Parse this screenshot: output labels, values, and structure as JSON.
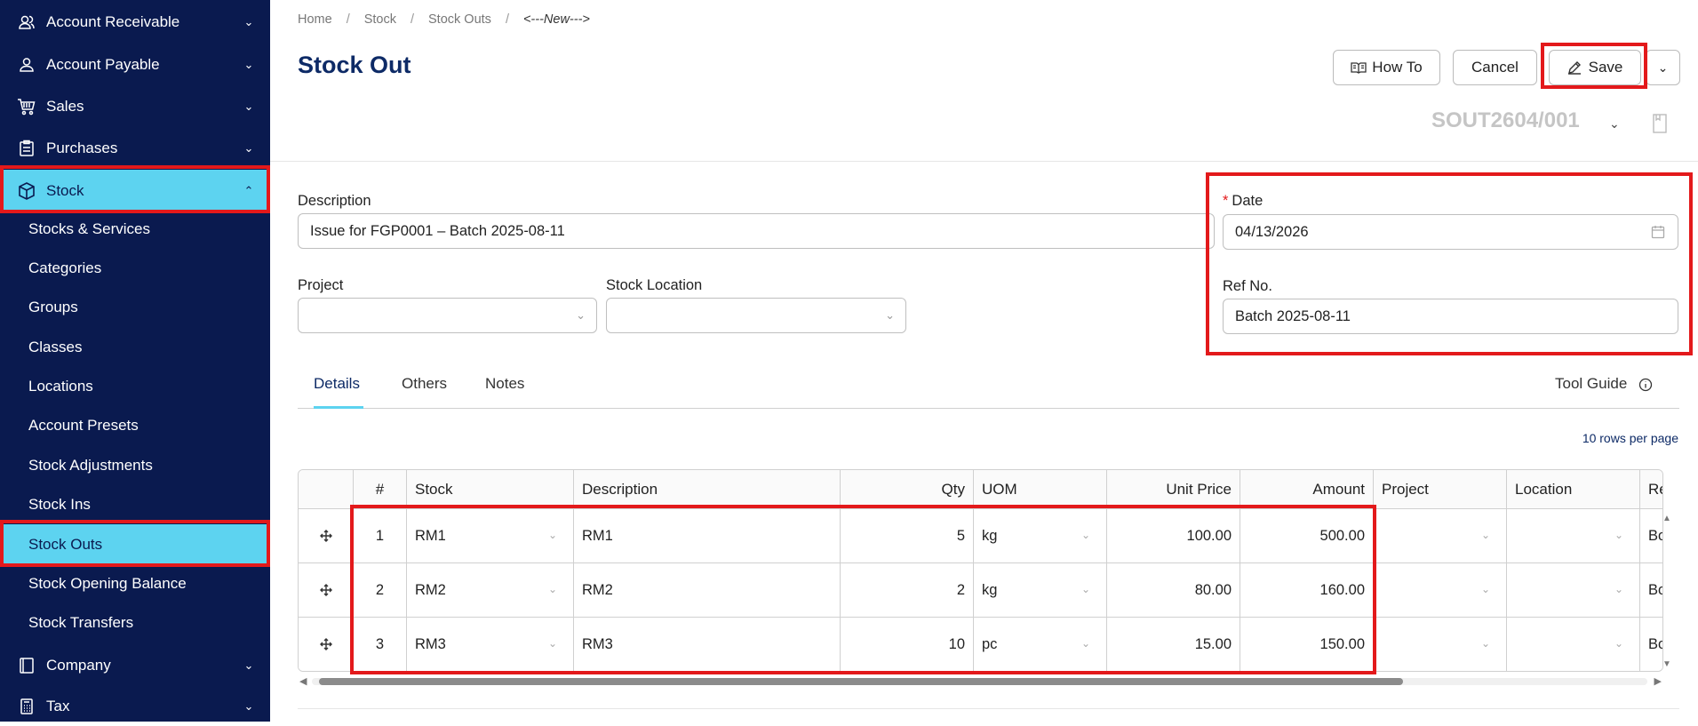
{
  "sidebar": {
    "groups": [
      {
        "label": "Account Receivable",
        "icon": "users-icon"
      },
      {
        "label": "Account Payable",
        "icon": "user-icon"
      },
      {
        "label": "Sales",
        "icon": "cart-icon"
      },
      {
        "label": "Purchases",
        "icon": "clipboard-icon"
      },
      {
        "label": "Stock",
        "icon": "box-icon"
      },
      {
        "label": "Company",
        "icon": "book-icon"
      },
      {
        "label": "Tax",
        "icon": "calculator-icon"
      }
    ],
    "stock_items": [
      "Stocks & Services",
      "Categories",
      "Groups",
      "Classes",
      "Locations",
      "Account Presets",
      "Stock Adjustments",
      "Stock Ins",
      "Stock Outs",
      "Stock Opening Balance",
      "Stock Transfers"
    ]
  },
  "breadcrumb": [
    "Home",
    "Stock",
    "Stock Outs",
    "<---New--->"
  ],
  "page_title": "Stock Out",
  "toolbar": {
    "howto_label": "How To",
    "cancel_label": "Cancel",
    "save_label": "Save"
  },
  "doc_number": "SOUT2604/001",
  "form": {
    "description_label": "Description",
    "description_value": "Issue for FGP0001 – Batch 2025-08-11",
    "date_label": "Date",
    "date_required_mark": "*",
    "date_value": "04/13/2026",
    "project_label": "Project",
    "project_value": "",
    "location_label": "Stock Location",
    "location_value": "",
    "refno_label": "Ref No.",
    "refno_value": "Batch 2025-08-11"
  },
  "tabs": {
    "details": "Details",
    "others": "Others",
    "notes": "Notes",
    "tool_guide": "Tool Guide"
  },
  "rows_per_page": "10 rows per page",
  "table": {
    "headers": {
      "num": "#",
      "stock": "Stock",
      "description": "Description",
      "qty": "Qty",
      "uom": "UOM",
      "unit_price": "Unit Price",
      "amount": "Amount",
      "project": "Project",
      "location": "Location",
      "re": "Re"
    },
    "rows": [
      {
        "num": "1",
        "stock": "RM1",
        "description": "RM1",
        "qty": "5",
        "uom": "kg",
        "unit_price": "100.00",
        "amount": "500.00",
        "re": "Bo"
      },
      {
        "num": "2",
        "stock": "RM2",
        "description": "RM2",
        "qty": "2",
        "uom": "kg",
        "unit_price": "80.00",
        "amount": "160.00",
        "re": "Bo"
      },
      {
        "num": "3",
        "stock": "RM3",
        "description": "RM3",
        "qty": "10",
        "uom": "pc",
        "unit_price": "15.00",
        "amount": "150.00",
        "re": "Bo"
      }
    ]
  },
  "colors": {
    "sidebar_bg": "#0a1a4f",
    "active_bg": "#5dd3f0",
    "title": "#0d2a66",
    "highlight": "#e3191b"
  }
}
